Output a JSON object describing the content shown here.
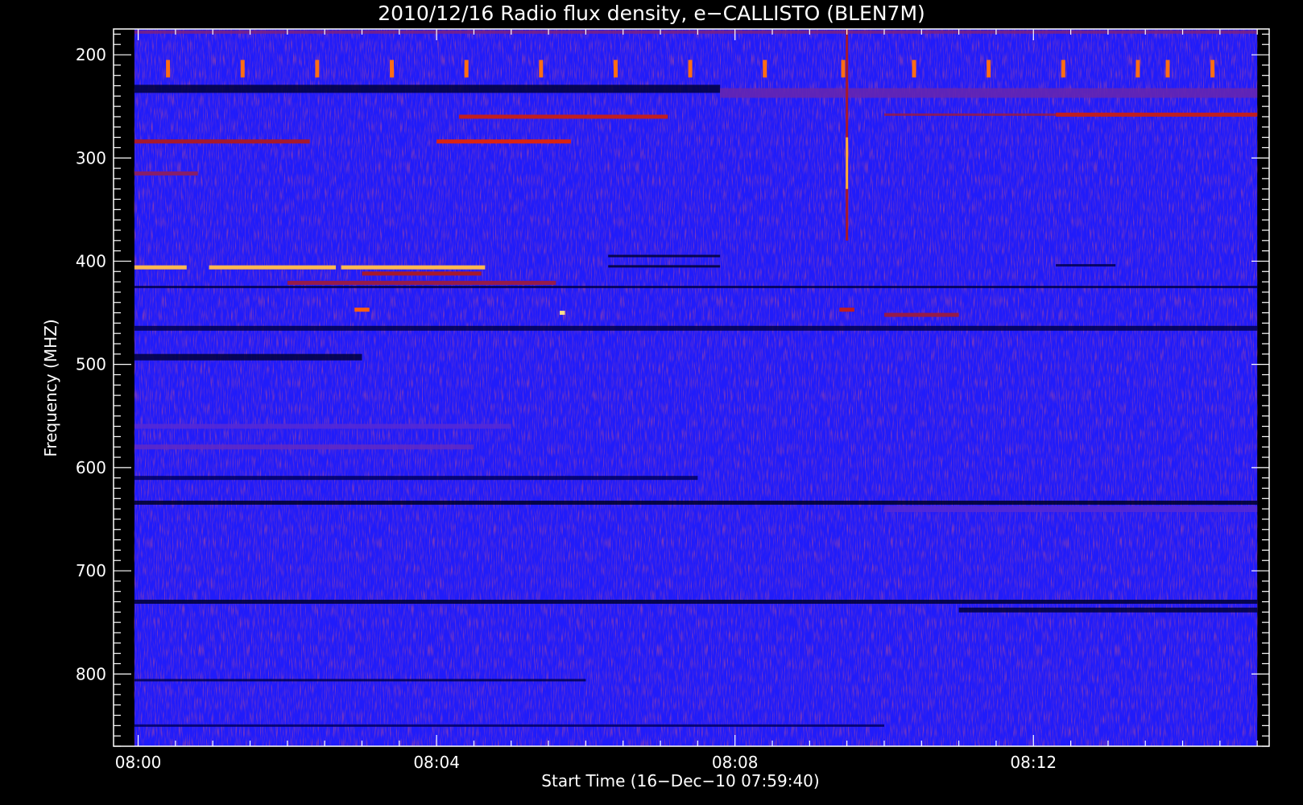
{
  "chart_data": {
    "type": "heatmap",
    "title": "2010/12/16  Radio flux density, e−CALLISTO (BLEN7M)",
    "xlabel": "Start Time (16−Dec−10 07:59:40)",
    "ylabel": "Frequency (MHZ)",
    "x_unit": "minutes after 08:00 UT",
    "xlim": [
      -0.33,
      15.16
    ],
    "ylim": [
      175,
      870
    ],
    "y_inverted": true,
    "data_extent": {
      "time_start": -0.05,
      "time_end": 15.0,
      "freq_min": 175,
      "freq_max": 870
    },
    "x_ticks": [
      {
        "value": 0,
        "label": "08:00"
      },
      {
        "value": 4,
        "label": "08:04"
      },
      {
        "value": 8,
        "label": "08:08"
      },
      {
        "value": 12,
        "label": "08:12"
      }
    ],
    "y_ticks": [
      {
        "value": 200,
        "label": "200"
      },
      {
        "value": 300,
        "label": "300"
      },
      {
        "value": 400,
        "label": "400"
      },
      {
        "value": 500,
        "label": "500"
      },
      {
        "value": 600,
        "label": "600"
      },
      {
        "value": 700,
        "label": "700"
      },
      {
        "value": 800,
        "label": "800"
      }
    ],
    "colormap": [
      "#000000",
      "#00008c",
      "#1a1aff",
      "#5a2ad0",
      "#a01830",
      "#ff2a00",
      "#ff9a20",
      "#ffffc0"
    ],
    "background_level": 0.3,
    "horizontal_bands": [
      {
        "freq": 178,
        "t0": -0.05,
        "t1": 15.0,
        "level": 0.5,
        "thickness": 4
      },
      {
        "freq": 233,
        "t0": -0.05,
        "t1": 7.8,
        "level": 0.06,
        "thickness": 10
      },
      {
        "freq": 237,
        "t0": 7.8,
        "t1": 15.0,
        "level": 0.46,
        "thickness": 12
      },
      {
        "freq": 258,
        "t0": 10.0,
        "t1": 15.0,
        "level": 0.55,
        "thickness": 3
      },
      {
        "freq": 395,
        "t0": 6.3,
        "t1": 7.8,
        "level": 0.05,
        "thickness": 3
      },
      {
        "freq": 405,
        "t0": 6.3,
        "t1": 7.8,
        "level": 0.05,
        "thickness": 3
      },
      {
        "freq": 404,
        "t0": 12.3,
        "t1": 13.1,
        "level": 0.08,
        "thickness": 3
      },
      {
        "freq": 425,
        "t0": -0.05,
        "t1": 15.0,
        "level": 0.08,
        "thickness": 3
      },
      {
        "freq": 465,
        "t0": -0.05,
        "t1": 15.0,
        "level": 0.08,
        "thickness": 6
      },
      {
        "freq": 493,
        "t0": -0.05,
        "t1": 3.0,
        "level": 0.06,
        "thickness": 8
      },
      {
        "freq": 560,
        "t0": -0.05,
        "t1": 5.0,
        "level": 0.42,
        "thickness": 6
      },
      {
        "freq": 580,
        "t0": -0.05,
        "t1": 4.5,
        "level": 0.44,
        "thickness": 6
      },
      {
        "freq": 610,
        "t0": -0.05,
        "t1": 7.5,
        "level": 0.1,
        "thickness": 5
      },
      {
        "freq": 634,
        "t0": -0.05,
        "t1": 15.0,
        "level": 0.04,
        "thickness": 5
      },
      {
        "freq": 640,
        "t0": 10.0,
        "t1": 15.0,
        "level": 0.42,
        "thickness": 8
      },
      {
        "freq": 730,
        "t0": -0.05,
        "t1": 15.0,
        "level": 0.05,
        "thickness": 5
      },
      {
        "freq": 738,
        "t0": 11.0,
        "t1": 15.0,
        "level": 0.06,
        "thickness": 6
      },
      {
        "freq": 806,
        "t0": -0.05,
        "t1": 6.0,
        "level": 0.08,
        "thickness": 3
      },
      {
        "freq": 850,
        "t0": -0.05,
        "t1": 10.0,
        "level": 0.1,
        "thickness": 3
      }
    ],
    "emission_segments": [
      {
        "freq": 406,
        "t0": -0.05,
        "t1": 0.65,
        "level": 0.9
      },
      {
        "freq": 406,
        "t0": 0.95,
        "t1": 2.65,
        "level": 0.9
      },
      {
        "freq": 406,
        "t0": 2.72,
        "t1": 4.65,
        "level": 0.9
      },
      {
        "freq": 412,
        "t0": 3.0,
        "t1": 4.6,
        "level": 0.58
      },
      {
        "freq": 421,
        "t0": 2.0,
        "t1": 5.6,
        "level": 0.55
      },
      {
        "freq": 260,
        "t0": 4.3,
        "t1": 7.1,
        "level": 0.62
      },
      {
        "freq": 258,
        "t0": 12.3,
        "t1": 15.0,
        "level": 0.62
      },
      {
        "freq": 284,
        "t0": -0.05,
        "t1": 2.3,
        "level": 0.58
      },
      {
        "freq": 284,
        "t0": 4.0,
        "t1": 5.8,
        "level": 0.66
      },
      {
        "freq": 315,
        "t0": -0.05,
        "t1": 0.8,
        "level": 0.52
      },
      {
        "freq": 447,
        "t0": 2.9,
        "t1": 3.1,
        "level": 0.78
      },
      {
        "freq": 447,
        "t0": 9.4,
        "t1": 9.6,
        "level": 0.62
      },
      {
        "freq": 450,
        "t0": 5.65,
        "t1": 5.72,
        "level": 0.95
      },
      {
        "freq": 452,
        "t0": 10.0,
        "t1": 11.0,
        "level": 0.55
      }
    ],
    "periodic_bursts": {
      "freq_min": 205,
      "freq_max": 222,
      "times": [
        0.4,
        1.4,
        2.4,
        3.4,
        4.4,
        5.4,
        6.4,
        7.4,
        8.4,
        9.45,
        10.4,
        11.4,
        12.4,
        13.4,
        13.8,
        14.4
      ],
      "level": 0.8
    },
    "vertical_bursts": [
      {
        "time": 9.5,
        "freq_min": 175,
        "freq_max": 380,
        "peak_freq_min": 280,
        "peak_freq_max": 330,
        "level": 0.88
      }
    ]
  }
}
